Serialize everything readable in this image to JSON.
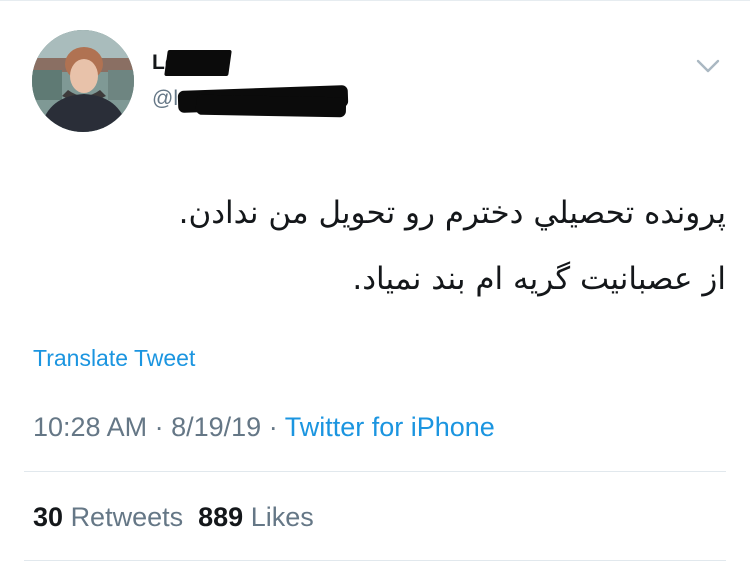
{
  "tweet": {
    "author": {
      "name": "Leyla",
      "handle": "@l"
    },
    "text_lines": [
      "پرونده تحصيلي دخترم رو تحويل من ندادن.",
      "از عصبانيت گريه ام بند نمياد."
    ],
    "translate_label": "Translate Tweet",
    "time": "10:28 AM",
    "date": "8/19/19",
    "separator": "·",
    "source": "Twitter for iPhone",
    "retweets": {
      "count": "30",
      "label": "Retweets"
    },
    "likes": {
      "count": "889",
      "label": "Likes"
    }
  },
  "icons": {
    "menu": "chevron-down-icon"
  },
  "colors": {
    "link": "#1b95e0",
    "secondary_text": "#657786",
    "primary_text": "#14171a",
    "divider": "#e1e8ed"
  }
}
